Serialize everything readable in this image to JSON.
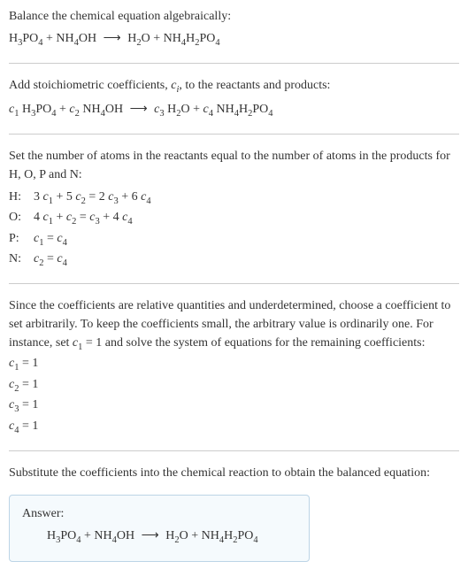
{
  "step1": {
    "text": "Balance the chemical equation algebraically:",
    "equation": "H₃PO₄ + NH₄OH ⟶ H₂O + NH₄H₂PO₄"
  },
  "step2": {
    "text_a": "Add stoichiometric coefficients, ",
    "text_b": ", to the reactants and products:",
    "ci": "cᵢ",
    "equation": "c₁ H₃PO₄ + c₂ NH₄OH ⟶ c₃ H₂O + c₄ NH₄H₂PO₄"
  },
  "step3": {
    "text": "Set the number of atoms in the reactants equal to the number of atoms in the products for H, O, P and N:",
    "rows": [
      {
        "label": "H:",
        "eq": "3 c₁ + 5 c₂ = 2 c₃ + 6 c₄"
      },
      {
        "label": "O:",
        "eq": "4 c₁ + c₂ = c₃ + 4 c₄"
      },
      {
        "label": "P:",
        "eq": "c₁ = c₄"
      },
      {
        "label": "N:",
        "eq": "c₂ = c₄"
      }
    ]
  },
  "step4": {
    "text": "Since the coefficients are relative quantities and underdetermined, choose a coefficient to set arbitrarily. To keep the coefficients small, the arbitrary value is ordinarily one. For instance, set c₁ = 1 and solve the system of equations for the remaining coefficients:",
    "lines": [
      "c₁ = 1",
      "c₂ = 1",
      "c₃ = 1",
      "c₄ = 1"
    ]
  },
  "step5": {
    "text": "Substitute the coefficients into the chemical reaction to obtain the balanced equation:"
  },
  "answer": {
    "label": "Answer:",
    "equation": "H₃PO₄ + NH₄OH ⟶ H₂O + NH₄H₂PO₄"
  },
  "chart_data": {
    "type": "table",
    "title": "Balancing H3PO4 + NH4OH -> H2O + NH4H2PO4",
    "atom_balance": [
      {
        "element": "H",
        "equation": "3c1 + 5c2 = 2c3 + 6c4"
      },
      {
        "element": "O",
        "equation": "4c1 + c2 = c3 + 4c4"
      },
      {
        "element": "P",
        "equation": "c1 = c4"
      },
      {
        "element": "N",
        "equation": "c2 = c4"
      }
    ],
    "solution": {
      "c1": 1,
      "c2": 1,
      "c3": 1,
      "c4": 1
    },
    "balanced_equation": "H3PO4 + NH4OH -> H2O + NH4H2PO4"
  }
}
